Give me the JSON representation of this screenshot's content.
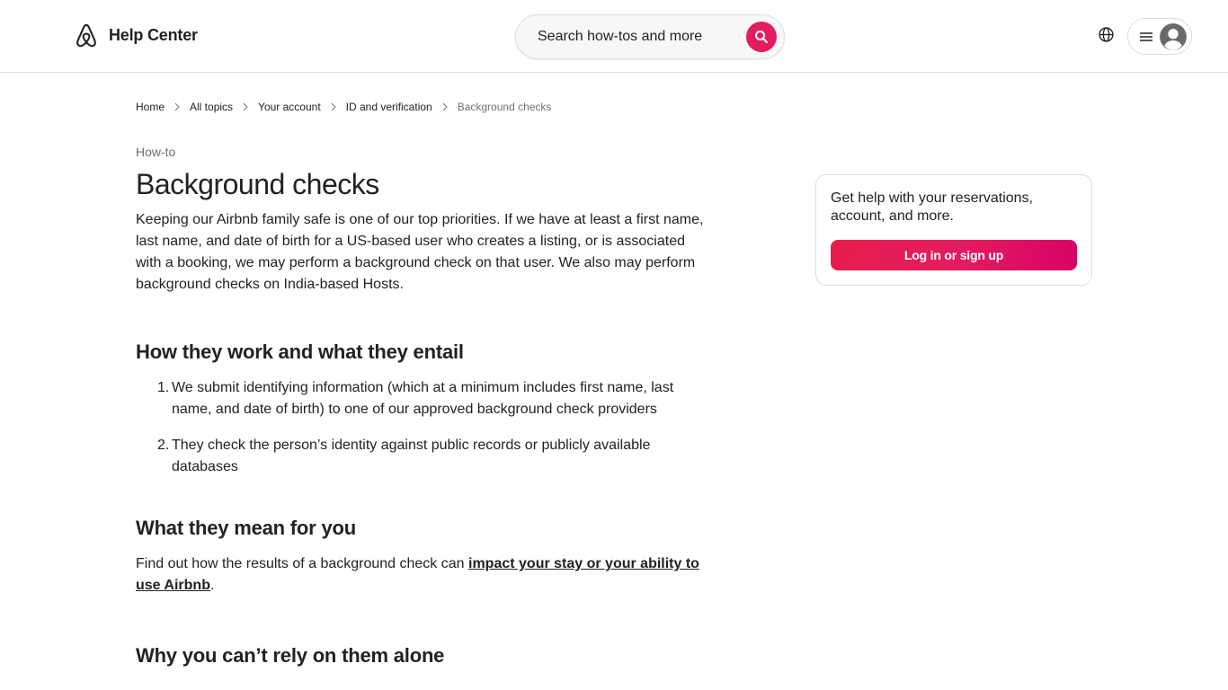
{
  "header": {
    "brand_name": "Help Center",
    "search_placeholder": "Search how-tos and more",
    "icons": {
      "logo": "airbnb-logo-icon",
      "search": "search-icon",
      "language": "globe-icon",
      "menu": "hamburger-menu-icon",
      "avatar": "user-avatar-icon"
    }
  },
  "breadcrumb": [
    {
      "label": "Home"
    },
    {
      "label": "All topics"
    },
    {
      "label": "Your account"
    },
    {
      "label": "ID and verification"
    },
    {
      "label": "Background checks"
    }
  ],
  "article": {
    "eyebrow": "How-to",
    "title": "Background checks",
    "intro": "Keeping our Airbnb family safe is one of our top priorities. If we have at least a first name, last name, and date of birth for a US-based user who creates a listing, or is associated with a booking, we may perform a background check on that user. We also may perform background checks on India-based Hosts.",
    "section1": {
      "heading": "How they work and what they entail",
      "items": [
        {
          "num": "1.",
          "text": "We submit identifying information (which at a minimum includes first name, last name, and date of birth) to one of our approved background check providers"
        },
        {
          "num": "2.",
          "text": "They check the person’s identity against public records or publicly available databases"
        }
      ]
    },
    "section2": {
      "heading": "What they mean for you",
      "text_before": "Find out how the results of a background check can ",
      "link": "impact your stay or your ability to use Airbnb",
      "text_after": "."
    },
    "section3": {
      "heading": "Why you can’t rely on them alone"
    }
  },
  "sidebar": {
    "card_text": "Get help with your reservations, account, and more.",
    "button_label": "Log in or sign up"
  },
  "colors": {
    "brand": "#e31c5f",
    "text": "#222222",
    "muted": "#717171",
    "border": "#dddddd"
  }
}
